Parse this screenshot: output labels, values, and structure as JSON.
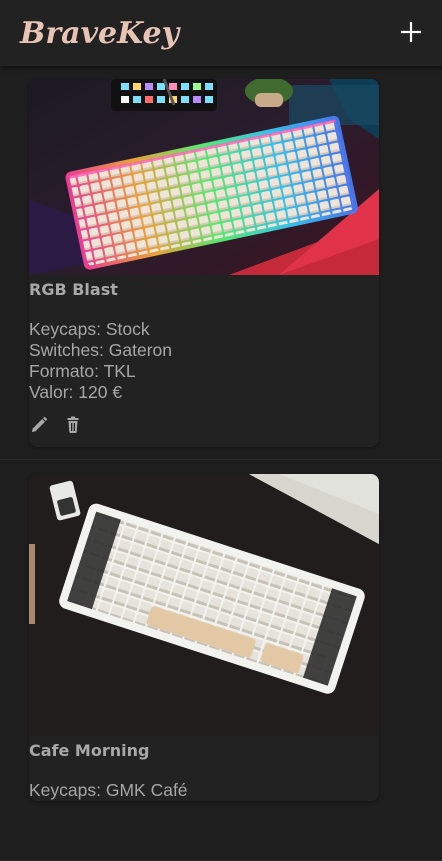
{
  "app": {
    "title": "BraveKey",
    "add_icon": "plus-icon"
  },
  "colors": {
    "background": "#1e1e1e",
    "surface": "#222222",
    "logo": "#e8c4b4",
    "text": "#a6a6a6"
  },
  "keyboards": [
    {
      "name": "RGB Blast",
      "lines": [
        "Keycaps: Stock",
        "Switches: Gateron",
        "Formato: TKL",
        "Valor: 120 €"
      ],
      "image": "rgb-keyboard-photo",
      "edit_icon": "pencil-icon",
      "delete_icon": "trash-icon"
    },
    {
      "name": "Cafe Morning",
      "lines": [
        "Keycaps: GMK Café"
      ],
      "image": "cafe-keyboard-photo"
    }
  ]
}
